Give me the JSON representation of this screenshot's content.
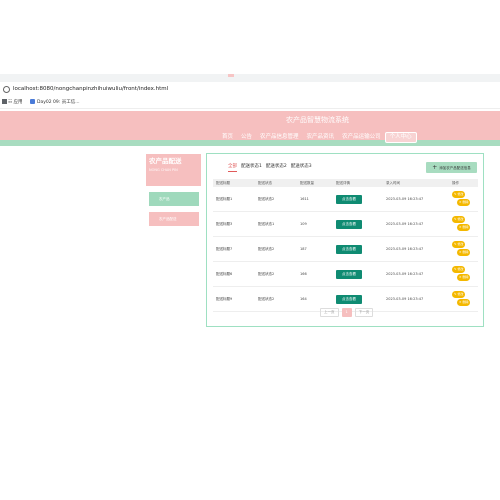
{
  "browser": {
    "url": "localhost:8080/nongchanpinzhihuiwuliu/front/index.html",
    "bookmarks": [
      "☷ 应用",
      "Day02 09: 员工信..."
    ]
  },
  "header": {
    "site_title": "农产品智慧物流系统",
    "nav": [
      "首页",
      "公告",
      "农产品信息管理",
      "农产品资讯",
      "农产品运输公司",
      "个人中心"
    ]
  },
  "sidebar": {
    "title": "农产品配送",
    "subtitle": "NONG CHAN PIN",
    "items": [
      "农产品",
      "农产品配送"
    ]
  },
  "filters": [
    "全部",
    "配送状态1",
    "配送状态2",
    "配送状态3"
  ],
  "add_button": "添加农产品配送信息",
  "table": {
    "headers": [
      "配送标题",
      "配送状态",
      "配送数量",
      "配送详情",
      "录入时间",
      "操作"
    ],
    "rows": [
      {
        "title": "配送标题1",
        "status": "配送状态2",
        "qty": "1611",
        "time": "2023-03-09 16:23:47"
      },
      {
        "title": "配送标题3",
        "status": "配送状态1",
        "qty": "109",
        "time": "2023-03-09 16:23:47"
      },
      {
        "title": "配送标题7",
        "status": "配送状态2",
        "qty": "187",
        "time": "2023-03-09 16:23:47"
      },
      {
        "title": "配送标题6",
        "status": "配送状态2",
        "qty": "166",
        "time": "2023-03-09 16:23:47"
      },
      {
        "title": "配送标题9",
        "status": "配送状态2",
        "qty": "164",
        "time": "2023-03-09 16:23:47"
      }
    ],
    "view_label": "点击查看",
    "edit_label": "修改",
    "delete_label": "删除"
  },
  "pager": {
    "prev": "上一页",
    "current": "1",
    "next": "下一页"
  },
  "colors": {
    "brand_pink": "#f6bfbf",
    "brand_green": "#a8dcc0",
    "view_button": "#0f8b72",
    "op_button": "#f4b800",
    "active_filter": "#e05a5a"
  }
}
